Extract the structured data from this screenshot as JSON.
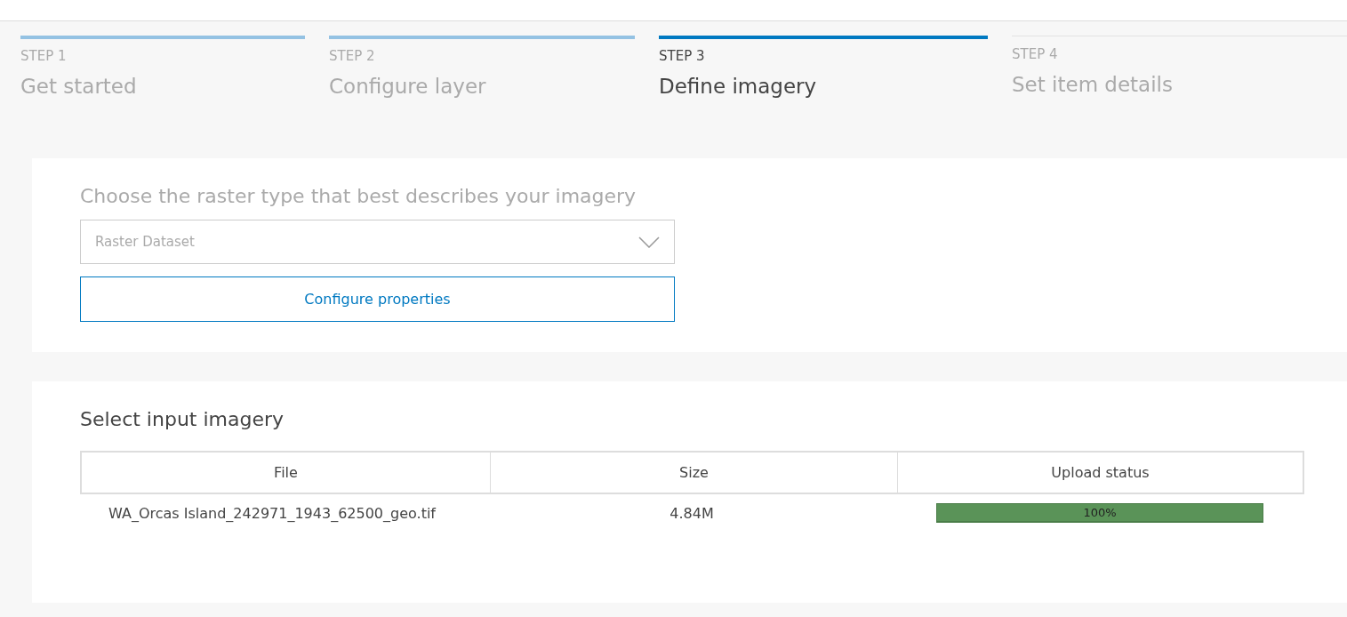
{
  "steps": [
    {
      "number": "STEP 1",
      "title": "Get started",
      "complete": true,
      "selected": false
    },
    {
      "number": "STEP 2",
      "title": "Configure layer",
      "complete": true,
      "selected": false
    },
    {
      "number": "STEP 3",
      "title": "Define imagery",
      "complete": false,
      "selected": true
    },
    {
      "number": "STEP 4",
      "title": "Set item details",
      "complete": false,
      "selected": false
    }
  ],
  "raster_type": {
    "heading": "Choose the raster type that best describes your imagery",
    "select": {
      "value": "Raster Dataset"
    },
    "button": "Configure properties"
  },
  "input_imagery": {
    "heading": "Select input imagery",
    "table": {
      "columns": [
        "File",
        "Size",
        "Upload status"
      ],
      "rows": [
        {
          "file": "WA_Orcas Island_242971_1943_62500_geo.tif",
          "size": "4.84M",
          "status": "100%",
          "level": 1
        }
      ]
    }
  }
}
